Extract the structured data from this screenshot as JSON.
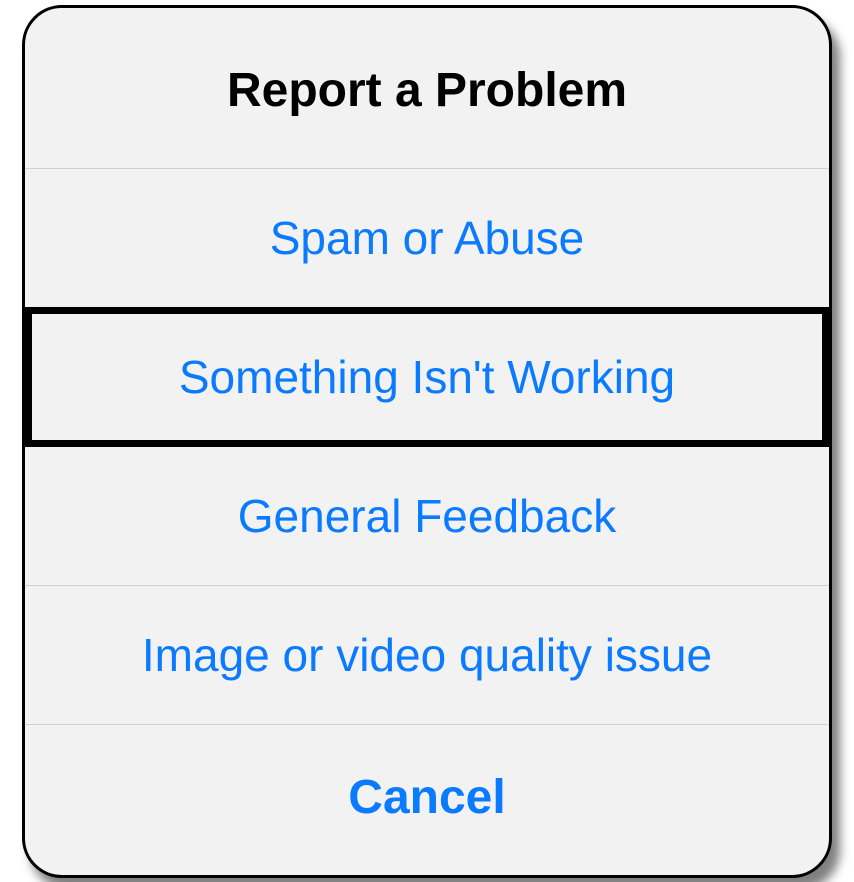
{
  "sheet": {
    "title": "Report a Problem",
    "options": [
      {
        "label": "Spam or Abuse",
        "highlighted": false
      },
      {
        "label": "Something Isn't Working",
        "highlighted": true
      },
      {
        "label": "General Feedback",
        "highlighted": false
      },
      {
        "label": "Image or video quality issue",
        "highlighted": false
      }
    ],
    "cancel_label": "Cancel"
  }
}
